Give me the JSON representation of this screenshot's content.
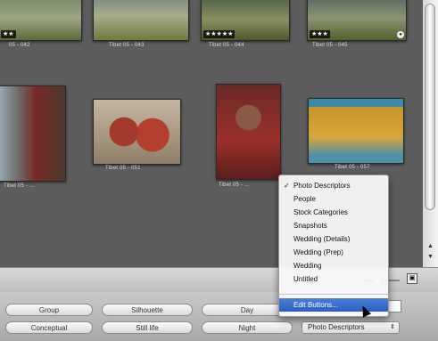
{
  "browser": {
    "top_row": [
      {
        "caption": "05 - 042",
        "rating": "★★",
        "has_badge": false
      },
      {
        "caption": "Tibet 05 - 043",
        "rating": "",
        "has_badge": false
      },
      {
        "caption": "Tibet 05 - 044",
        "rating": "★★★★★",
        "has_badge": false
      },
      {
        "caption": "Tibet 05 - 045",
        "rating": "★★★",
        "has_badge": true
      }
    ],
    "middle_row": [
      {
        "caption": "Tibet 05 - ..."
      },
      {
        "caption": "Tibet 05 - 051"
      },
      {
        "caption": "Tibet 05 - ..."
      },
      {
        "caption": "Tibet 05 - 057"
      }
    ]
  },
  "scrollbar": {
    "up_arrow": "▲",
    "down_arrow": "▼"
  },
  "zoom": {
    "icon": "▣"
  },
  "keyword_buttons": [
    {
      "label": "Group"
    },
    {
      "label": "Silhouette"
    },
    {
      "label": "Day"
    },
    {
      "label": "Conceptual"
    },
    {
      "label": "Still life"
    },
    {
      "label": "Night"
    }
  ],
  "popup": {
    "selected": "Photo Descriptors",
    "arrow": "⇕"
  },
  "menu": {
    "checkmark": "✓",
    "items": [
      "Photo Descriptors",
      "People",
      "Stock Categories",
      "Snapshots",
      "Wedding (Details)",
      "Wedding (Prep)",
      "Wedding",
      "Untitled"
    ],
    "edit_item": "Edit Buttons..."
  },
  "colors": {
    "menu_highlight": "#2a5fc0",
    "background": "#5e5e5e"
  }
}
